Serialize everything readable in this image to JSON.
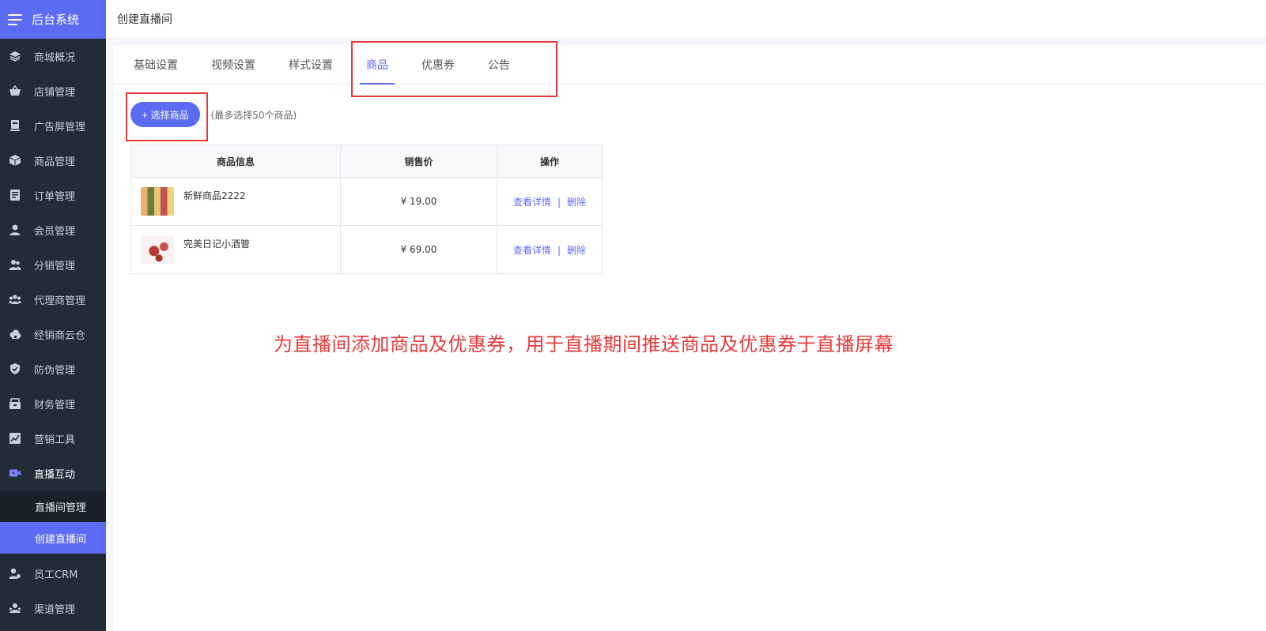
{
  "app": {
    "title": "后台系统"
  },
  "header": {
    "title": "创建直播间"
  },
  "sidebar": {
    "items": [
      {
        "label": "商城概况",
        "icon": "layers-icon"
      },
      {
        "label": "店铺管理",
        "icon": "basket-icon"
      },
      {
        "label": "广告屏管理",
        "icon": "billboard-icon"
      },
      {
        "label": "商品管理",
        "icon": "box-icon"
      },
      {
        "label": "订单管理",
        "icon": "document-icon"
      },
      {
        "label": "会员管理",
        "icon": "user-icon"
      },
      {
        "label": "分销管理",
        "icon": "users-icon"
      },
      {
        "label": "代理商管理",
        "icon": "group-icon"
      },
      {
        "label": "经销商云仓",
        "icon": "cloud-warehouse-icon"
      },
      {
        "label": "防伪管理",
        "icon": "shield-check-icon"
      },
      {
        "label": "财务管理",
        "icon": "wallet-icon"
      },
      {
        "label": "营销工具",
        "icon": "chart-icon"
      },
      {
        "label": "直播互动",
        "icon": "video-icon"
      }
    ],
    "sub_items": [
      {
        "label": "直播间管理"
      },
      {
        "label": "创建直播间"
      }
    ],
    "after_items": [
      {
        "label": "员工CRM",
        "icon": "staff-icon"
      },
      {
        "label": "渠道管理",
        "icon": "channel-icon"
      }
    ]
  },
  "tabs": [
    {
      "label": "基础设置"
    },
    {
      "label": "视频设置"
    },
    {
      "label": "样式设置"
    },
    {
      "label": "商品"
    },
    {
      "label": "优惠券"
    },
    {
      "label": "公告"
    }
  ],
  "toolbar": {
    "select_button": "选择商品",
    "plus": "+",
    "hint": "(最多选择50个商品)"
  },
  "table": {
    "headers": [
      "商品信息",
      "销售价",
      "操作"
    ],
    "rows": [
      {
        "name": "新鲜商品2222",
        "price": "¥ 19.00",
        "detail": "查看详情",
        "sep": "|",
        "delete": "删除"
      },
      {
        "name": "完美日记小酒管",
        "price": "¥ 69.00",
        "detail": "查看详情",
        "sep": "|",
        "delete": "删除"
      }
    ]
  },
  "annotation": "为直播间添加商品及优惠券，用于直播期间推送商品及优惠券于直播屏幕",
  "colors": {
    "accent": "#5b6cf2",
    "sidebar_bg": "#222b38",
    "highlight_red": "#e53a3a"
  }
}
